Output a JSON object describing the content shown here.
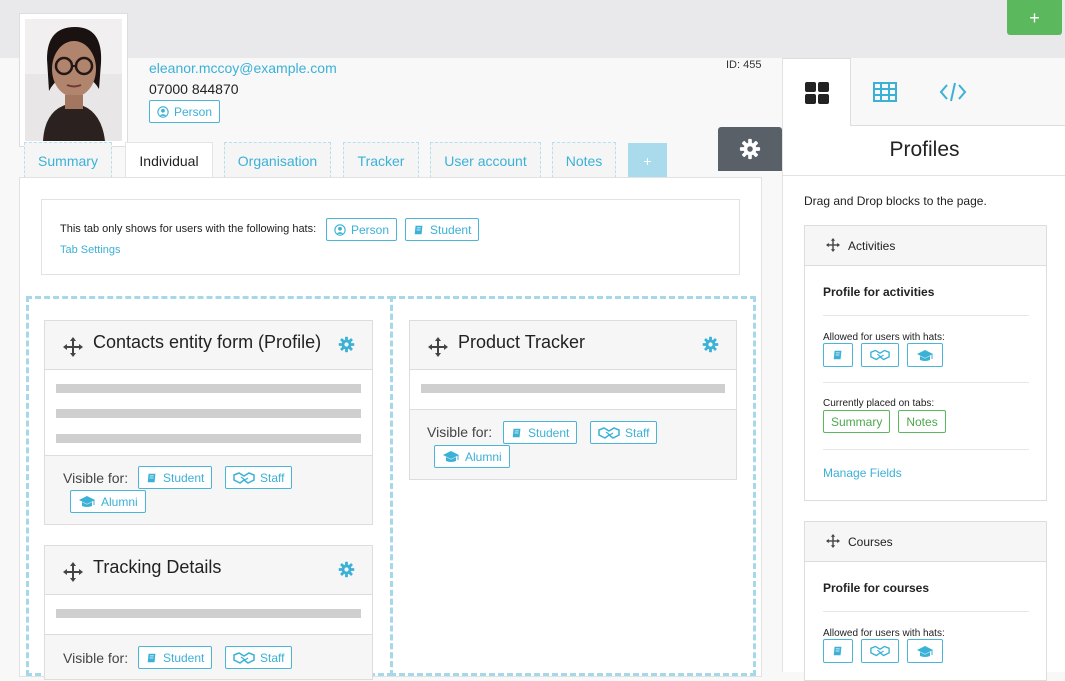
{
  "header": {
    "add_button_label": "+",
    "email": "eleanor.mccoy@example.com",
    "phone": "07000 844870",
    "id_label": "ID: 455",
    "hat_label": "Person"
  },
  "tabs": [
    {
      "label": "Summary",
      "active": false
    },
    {
      "label": "Individual",
      "active": true
    },
    {
      "label": "Organisation",
      "active": false
    },
    {
      "label": "Tracker",
      "active": false
    },
    {
      "label": "User account",
      "active": false
    },
    {
      "label": "Notes",
      "active": false
    }
  ],
  "tab_add_label": "+",
  "tab_info": {
    "text": "This tab only shows for users with the following hats:",
    "hats": [
      "Person",
      "Student"
    ],
    "settings_link": "Tab Settings"
  },
  "blocks": {
    "contacts": {
      "title": "Contacts entity form (Profile)",
      "visible_label": "Visible for:",
      "hats": [
        "Student",
        "Staff",
        "Alumni"
      ]
    },
    "tracker": {
      "title": "Product Tracker",
      "visible_label": "Visible for:",
      "hats": [
        "Student",
        "Staff",
        "Alumni"
      ]
    },
    "tracking": {
      "title": "Tracking Details",
      "visible_label": "Visible for:",
      "hats": [
        "Student",
        "Staff"
      ]
    }
  },
  "sidebar": {
    "tabs": [
      "blocks-icon",
      "table-icon",
      "code-icon"
    ],
    "title": "Profiles",
    "hint": "Drag and Drop blocks to the page.",
    "cards": {
      "activities": {
        "title": "Activities",
        "profile": "Profile for activities",
        "allowed_label": "Allowed for users with hats:",
        "placed_label": "Currently placed on tabs:",
        "placed_tabs": [
          "Summary",
          "Notes"
        ],
        "manage_link": "Manage Fields"
      },
      "courses": {
        "title": "Courses",
        "profile": "Profile for courses",
        "allowed_label": "Allowed for users with hats:"
      }
    }
  },
  "colors": {
    "accent": "#3bb1d6",
    "success": "#5cb85c",
    "dark": "#5a6067"
  }
}
